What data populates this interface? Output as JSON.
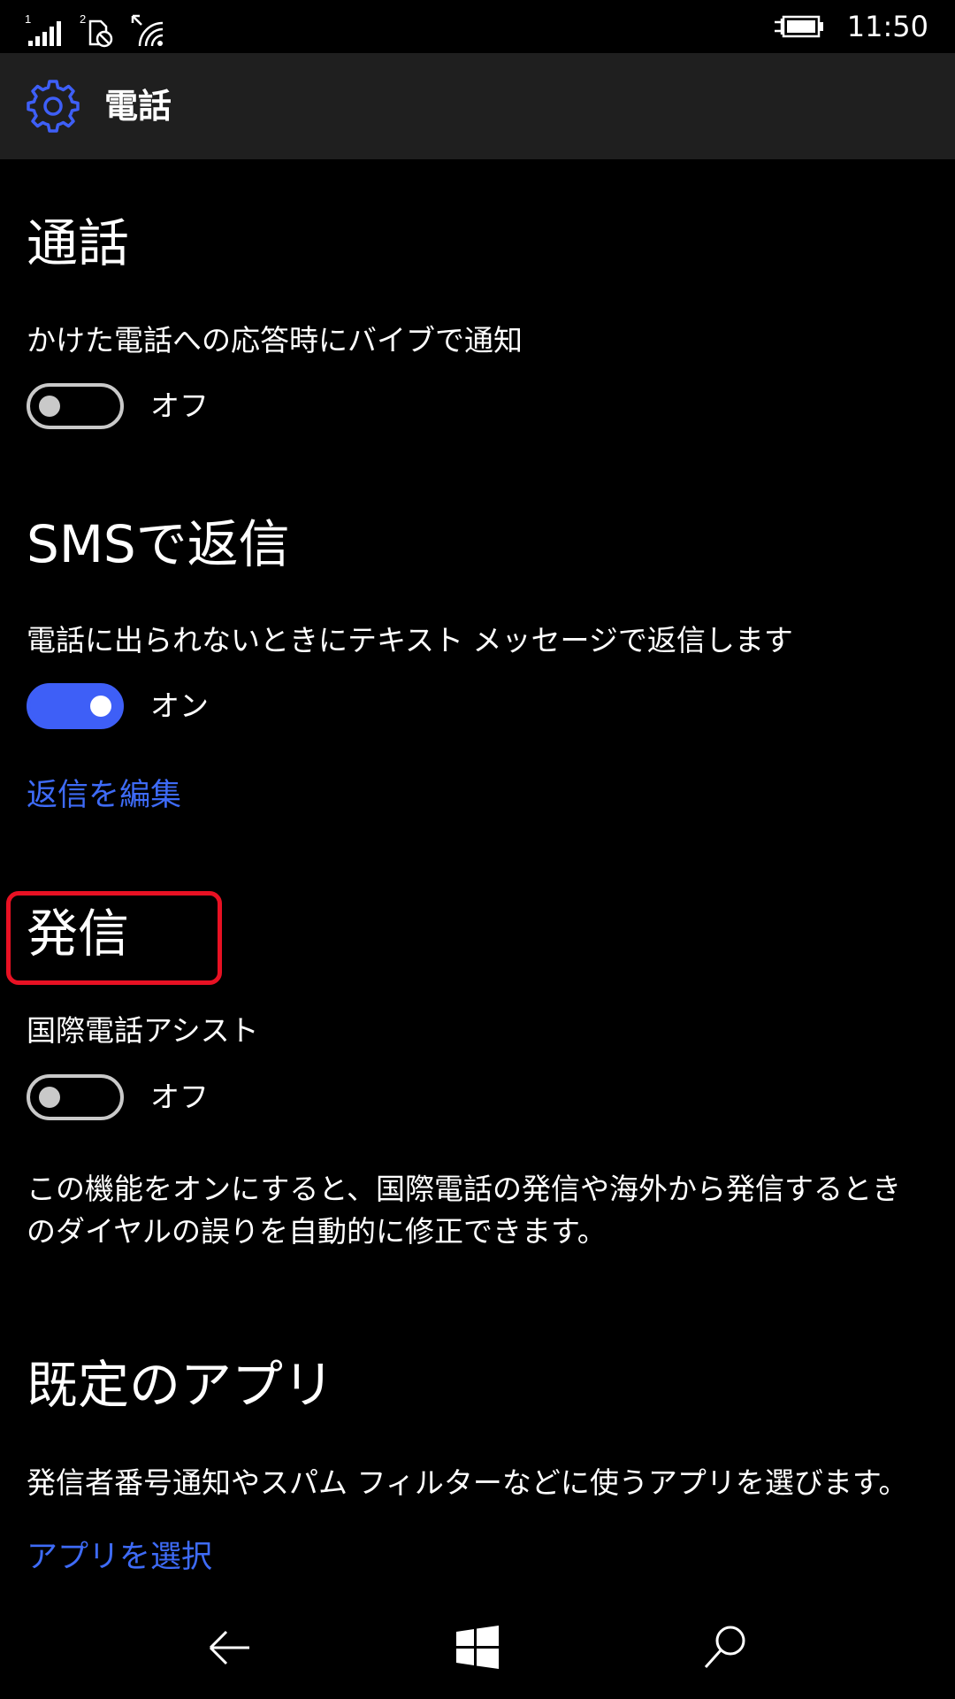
{
  "status_bar": {
    "sim1_label": "1",
    "sim2_label": "2",
    "time": "11:50"
  },
  "header": {
    "title": "電話",
    "icon": "gear-icon"
  },
  "sections": {
    "calls": {
      "heading": "通話",
      "vibrate_label": "かけた電話への応答時にバイブで通知",
      "vibrate_state": "オフ",
      "vibrate_on": false
    },
    "sms_reply": {
      "heading": "SMSで返信",
      "reply_label": "電話に出られないときにテキスト メッセージで返信します",
      "reply_state": "オン",
      "reply_on": true,
      "edit_link": "返信を編集"
    },
    "outgoing": {
      "heading": "発信",
      "assist_label": "国際電話アシスト",
      "assist_state": "オフ",
      "assist_on": false,
      "assist_description": "この機能をオンにすると、国際電話の発信や海外から発信するときのダイヤルの誤りを自動的に修正できます。"
    },
    "default_apps": {
      "heading": "既定のアプリ",
      "description": "発信者番号通知やスパム フィルターなどに使うアプリを選びます。",
      "choose_link": "アプリを選択"
    }
  },
  "nav": {
    "back_icon": "back-arrow-icon",
    "home_icon": "windows-logo-icon",
    "search_icon": "search-icon"
  },
  "colors": {
    "accent": "#3e5ff7",
    "link": "#3e6bf7",
    "highlight": "#e81123",
    "header_bg": "#1f1f1f",
    "background": "#000000"
  }
}
